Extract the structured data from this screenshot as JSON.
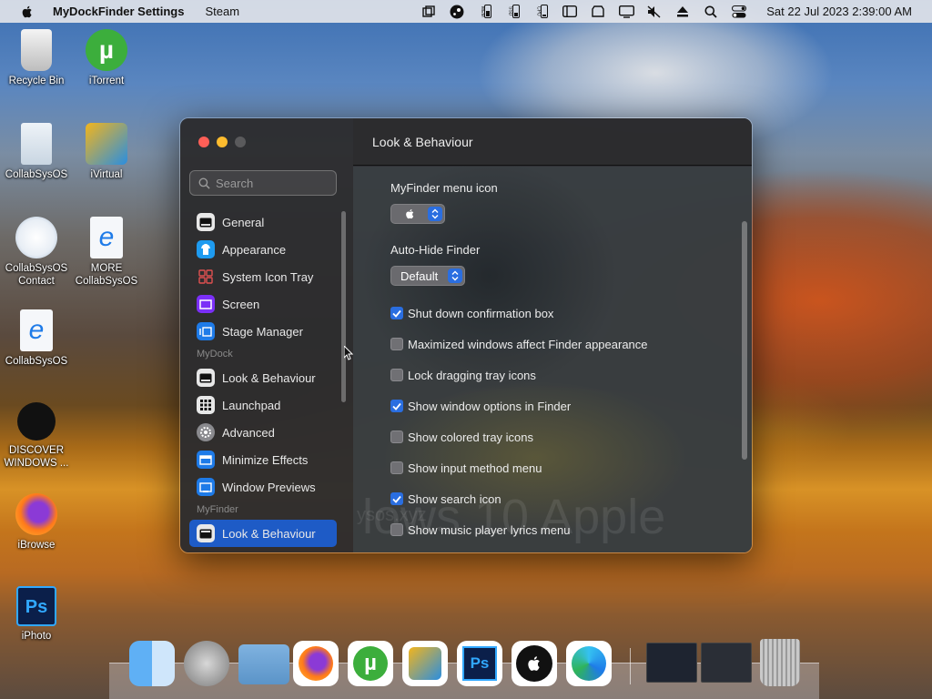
{
  "menubar": {
    "app_name": "MyDockFinder Settings",
    "menu_item": "Steam",
    "clock": "Sat 22 Jul 2023  2:39:00 AM",
    "status_icons": [
      "tray-app-icon",
      "steam-icon",
      "memory-meter-icon",
      "storage-meter-icon",
      "cpu-meter-icon",
      "battery-meter-icon",
      "sidebar-icon",
      "drive-icon",
      "display-icon",
      "mute-icon",
      "eject-icon",
      "search-icon",
      "control-center-icon"
    ],
    "meter_labels": {
      "mem": "MEM",
      "ssd": "SSD",
      "cpu": "CPU"
    }
  },
  "desktop": {
    "icons": [
      {
        "label": "Recycle Bin",
        "icon": "recycle-bin-icon"
      },
      {
        "label": "iTorrent",
        "icon": "utorrent-icon"
      },
      {
        "label": "CollabSysOS",
        "icon": "document-icon"
      },
      {
        "label": "iVirtual",
        "icon": "virtual-icon"
      },
      {
        "label": "CollabSysOS Contact",
        "icon": "windows-icon"
      },
      {
        "label": "MORE CollabSysOS",
        "icon": "ie-doc-icon"
      },
      {
        "label": "CollabSysOS",
        "icon": "ie-doc-icon"
      },
      {
        "label": "DISCOVER WINDOWS ...",
        "icon": "apple-circle-icon"
      },
      {
        "label": "iBrowse",
        "icon": "firefox-icon"
      },
      {
        "label": "iPhoto",
        "icon": "photoshop-icon"
      }
    ]
  },
  "window": {
    "search_placeholder": "Search",
    "title": "Look & Behaviour",
    "sidebar": {
      "items_top": [
        {
          "label": "General",
          "icon": "general-icon",
          "color": "#3a3a3c"
        },
        {
          "label": "Appearance",
          "icon": "appearance-icon",
          "color": "#1e9bf0"
        },
        {
          "label": "System Icon Tray",
          "icon": "tray-grid-icon",
          "color": "#c0392b"
        },
        {
          "label": "Screen",
          "icon": "screen-icon",
          "color": "#7b2ff7"
        },
        {
          "label": "Stage Manager",
          "icon": "stage-manager-icon",
          "color": "#1e7be8"
        }
      ],
      "group_mydock": "MyDock",
      "items_dock": [
        {
          "label": "Look & Behaviour",
          "icon": "dock-look-icon",
          "color": "#3a3a3c"
        },
        {
          "label": "Launchpad",
          "icon": "launchpad-icon",
          "color": "#3a3a3c"
        },
        {
          "label": "Advanced",
          "icon": "gear-icon",
          "color": "#5a5a5e"
        },
        {
          "label": "Minimize Effects",
          "icon": "minimize-icon",
          "color": "#1e7be8"
        },
        {
          "label": "Window Previews",
          "icon": "window-preview-icon",
          "color": "#1e7be8"
        }
      ],
      "group_myfinder": "MyFinder",
      "items_finder": [
        {
          "label": "Look & Behaviour",
          "icon": "finder-look-icon",
          "color": "#3a3a3c",
          "active": true
        }
      ]
    },
    "settings": {
      "menu_icon_label": "MyFinder menu icon",
      "autohide_label": "Auto-Hide Finder",
      "autohide_value": "Default",
      "checkboxes": [
        {
          "label": "Shut down confirmation box",
          "checked": true
        },
        {
          "label": "Maximized windows affect Finder appearance",
          "checked": false
        },
        {
          "label": "Lock dragging tray icons",
          "checked": false
        },
        {
          "label": "Show window options in Finder",
          "checked": true
        },
        {
          "label": "Show colored tray icons",
          "checked": false
        },
        {
          "label": "Show input method menu",
          "checked": false
        },
        {
          "label": "Show search icon",
          "checked": true
        },
        {
          "label": "Show music player lyrics menu",
          "checked": false
        }
      ]
    },
    "watermark": "lows 10 Apple",
    "watermark_sub": "ysos.xyz"
  },
  "dock": {
    "apps": [
      "finder-icon",
      "launchpad-rocket-icon",
      "folder-icon",
      "firefox-icon",
      "utorrent-icon",
      "virtual-icon",
      "photoshop-icon",
      "apple-circle-icon",
      "edge-icon",
      "window-thumbnail-1",
      "window-thumbnail-2",
      "trash-icon"
    ],
    "photoshop_text": "Ps"
  }
}
